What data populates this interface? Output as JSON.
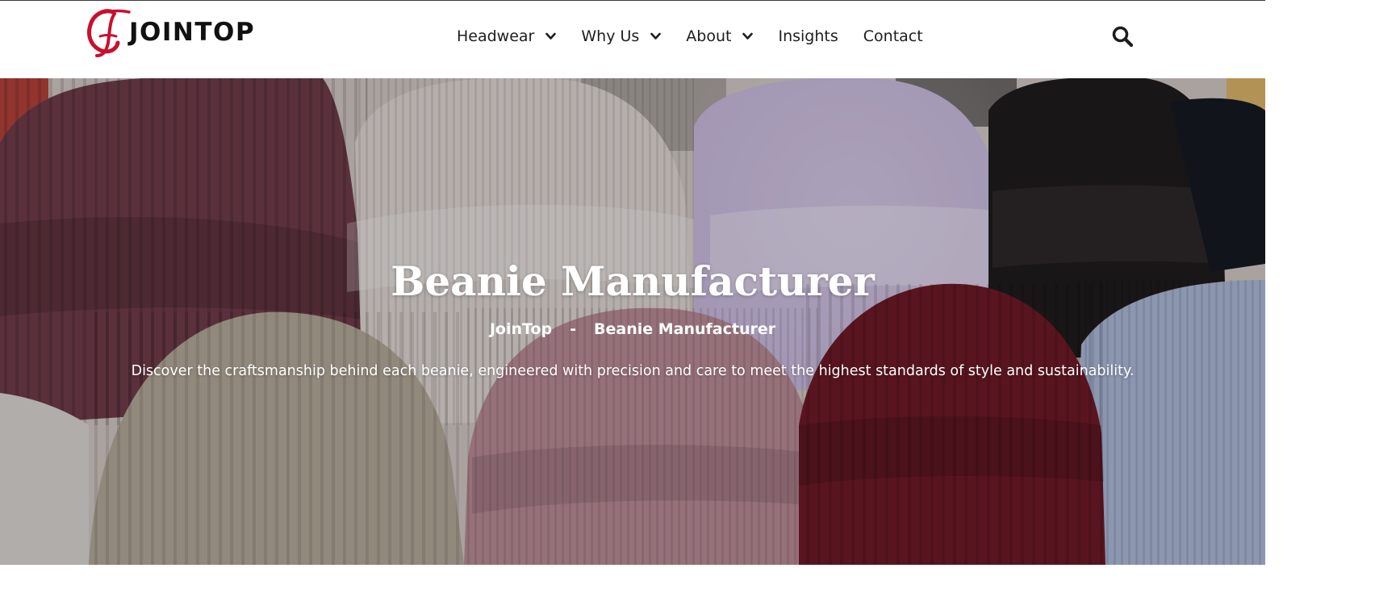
{
  "brand": {
    "name": "JOINTOP",
    "accent": "#c8102e"
  },
  "nav": {
    "items": [
      {
        "label": "Headwear",
        "has_dropdown": true
      },
      {
        "label": "Why Us",
        "has_dropdown": true
      },
      {
        "label": "About",
        "has_dropdown": true
      },
      {
        "label": "Insights",
        "has_dropdown": false
      },
      {
        "label": "Contact",
        "has_dropdown": false
      }
    ],
    "search_icon": "search-icon"
  },
  "hero": {
    "title": "Beanie Manufacturer",
    "breadcrumb": {
      "home": "JoinTop",
      "separator": "-",
      "current": "Beanie Manufacturer"
    },
    "description": "Discover the craftsmanship behind each beanie, engineered with precision and care to meet the highest standards of style and sustainability."
  }
}
